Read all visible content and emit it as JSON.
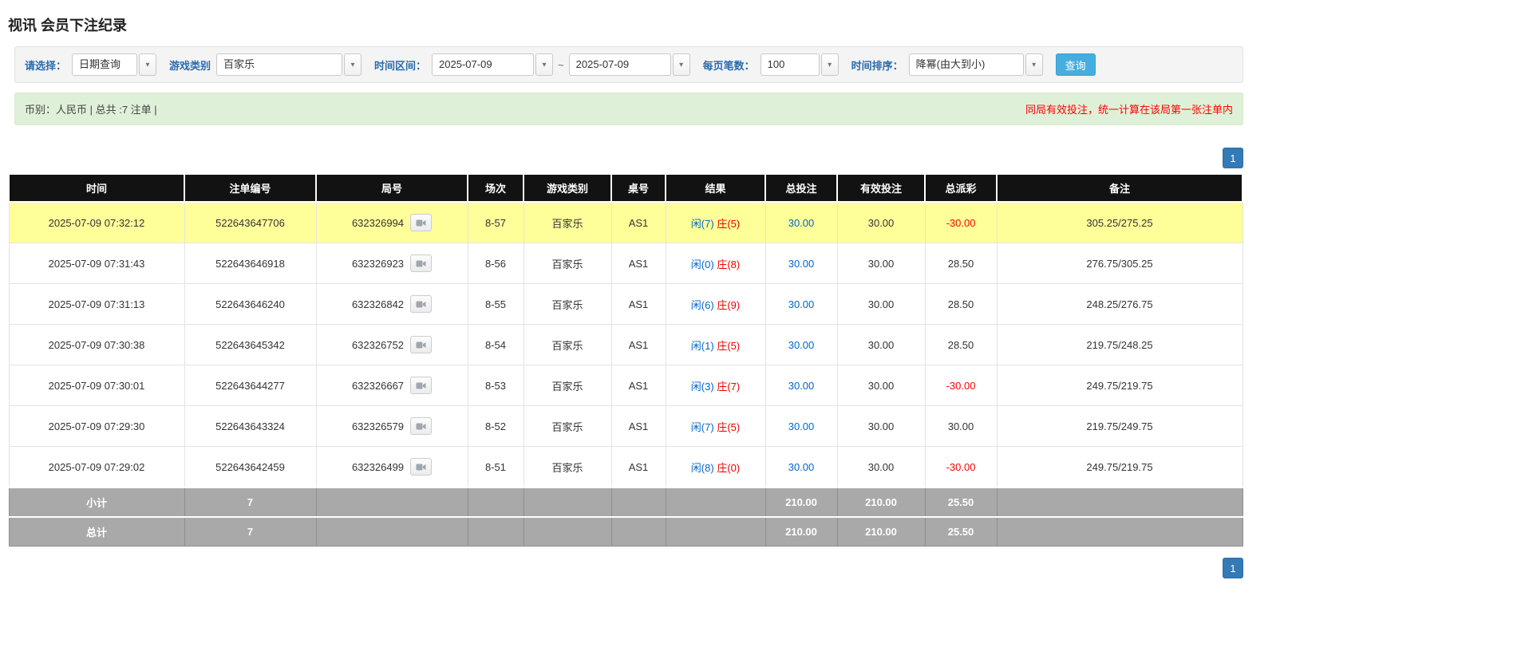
{
  "page": {
    "title": "视讯 会员下注纪录"
  },
  "filters": {
    "select_label": "请选择：",
    "select_value": "日期查询",
    "game_label": "游戏类别",
    "game_value": "百家乐",
    "range_label": "时间区间：",
    "date_from": "2025-07-09",
    "range_separator": "~",
    "date_to": "2025-07-09",
    "per_page_label": "每页笔数：",
    "per_page_value": "100",
    "sort_label": "时间排序：",
    "sort_value": "降幂(由大到小)",
    "query_button": "查询"
  },
  "summary": {
    "left": "币别：人民币 | 总共 :7 注单 |",
    "right": "同局有效投注，统一计算在该局第一张注单内"
  },
  "pagination": {
    "page": "1"
  },
  "icons": {
    "combo_arrow": "▾",
    "video_icon": "video-replay"
  },
  "colors": {
    "header_bg": "#121212",
    "highlight_row": "#ffff99",
    "player_blue": "#0066cc",
    "banker_red": "#ee0000",
    "negative_red": "#ff0000",
    "link_blue": "#0066cc",
    "pager_blue": "#337ab7",
    "query_button_bg": "#46aede",
    "summary_bg": "#dff0d8",
    "footer_bg": "#a9a9a9",
    "label_blue": "#2a6bac"
  },
  "table": {
    "headers": [
      "时间",
      "注单编号",
      "局号",
      "场次",
      "游戏类别",
      "桌号",
      "结果",
      "总投注",
      "有效投注",
      "总派彩",
      "备注"
    ],
    "rows": [
      {
        "time": "2025-07-09 07:32:12",
        "bet_id": "522643647706",
        "round_id": "632326994",
        "session": "8-57",
        "game": "百家乐",
        "table_no": "AS1",
        "result_player": "闲(7)",
        "result_banker": "庄(5)",
        "total_bet": "30.00",
        "valid_bet": "30.00",
        "payout": "-30.00",
        "remark": "305.25/275.25",
        "highlighted": true
      },
      {
        "time": "2025-07-09 07:31:43",
        "bet_id": "522643646918",
        "round_id": "632326923",
        "session": "8-56",
        "game": "百家乐",
        "table_no": "AS1",
        "result_player": "闲(0)",
        "result_banker": "庄(8)",
        "total_bet": "30.00",
        "valid_bet": "30.00",
        "payout": "28.50",
        "remark": "276.75/305.25",
        "highlighted": false
      },
      {
        "time": "2025-07-09 07:31:13",
        "bet_id": "522643646240",
        "round_id": "632326842",
        "session": "8-55",
        "game": "百家乐",
        "table_no": "AS1",
        "result_player": "闲(6)",
        "result_banker": "庄(9)",
        "total_bet": "30.00",
        "valid_bet": "30.00",
        "payout": "28.50",
        "remark": "248.25/276.75",
        "highlighted": false
      },
      {
        "time": "2025-07-09 07:30:38",
        "bet_id": "522643645342",
        "round_id": "632326752",
        "session": "8-54",
        "game": "百家乐",
        "table_no": "AS1",
        "result_player": "闲(1)",
        "result_banker": "庄(5)",
        "total_bet": "30.00",
        "valid_bet": "30.00",
        "payout": "28.50",
        "remark": "219.75/248.25",
        "highlighted": false
      },
      {
        "time": "2025-07-09 07:30:01",
        "bet_id": "522643644277",
        "round_id": "632326667",
        "session": "8-53",
        "game": "百家乐",
        "table_no": "AS1",
        "result_player": "闲(3)",
        "result_banker": "庄(7)",
        "total_bet": "30.00",
        "valid_bet": "30.00",
        "payout": "-30.00",
        "remark": "249.75/219.75",
        "highlighted": false
      },
      {
        "time": "2025-07-09 07:29:30",
        "bet_id": "522643643324",
        "round_id": "632326579",
        "session": "8-52",
        "game": "百家乐",
        "table_no": "AS1",
        "result_player": "闲(7)",
        "result_banker": "庄(5)",
        "total_bet": "30.00",
        "valid_bet": "30.00",
        "payout": "30.00",
        "remark": "219.75/249.75",
        "highlighted": false
      },
      {
        "time": "2025-07-09 07:29:02",
        "bet_id": "522643642459",
        "round_id": "632326499",
        "session": "8-51",
        "game": "百家乐",
        "table_no": "AS1",
        "result_player": "闲(8)",
        "result_banker": "庄(0)",
        "total_bet": "30.00",
        "valid_bet": "30.00",
        "payout": "-30.00",
        "remark": "249.75/219.75",
        "highlighted": false
      }
    ],
    "subtotal": {
      "label": "小计",
      "count": "7",
      "total_bet": "210.00",
      "valid_bet": "210.00",
      "payout": "25.50"
    },
    "total": {
      "label": "总计",
      "count": "7",
      "total_bet": "210.00",
      "valid_bet": "210.00",
      "payout": "25.50"
    }
  }
}
